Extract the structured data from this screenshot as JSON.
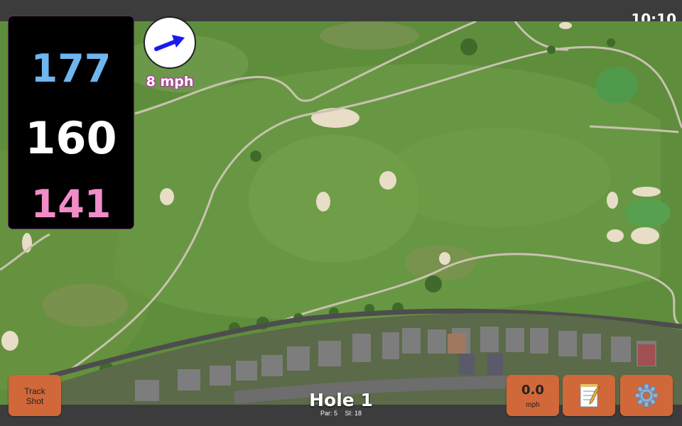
{
  "status_bar": {
    "time": "10:10"
  },
  "distances": {
    "back": "177",
    "center": "160",
    "front": "141"
  },
  "wind": {
    "speed_label": "8 mph",
    "direction_icon": "arrow-right-up-icon"
  },
  "hole": {
    "title": "Hole 1",
    "par": "Par: 5",
    "stroke_index": "SI: 18"
  },
  "buttons": {
    "track_shot_line1": "Track",
    "track_shot_line2": "Shot",
    "speed_value": "0.0",
    "speed_unit": "mph",
    "notes_icon": "notepad-icon",
    "settings_icon": "gear-icon"
  },
  "colors": {
    "button": "#d0683a",
    "back_distance": "#6fb5ee",
    "center_distance": "#ffffff",
    "front_distance": "#f08cc8",
    "wind_outline": "#b03aa0",
    "arrow": "#1a1aee"
  }
}
